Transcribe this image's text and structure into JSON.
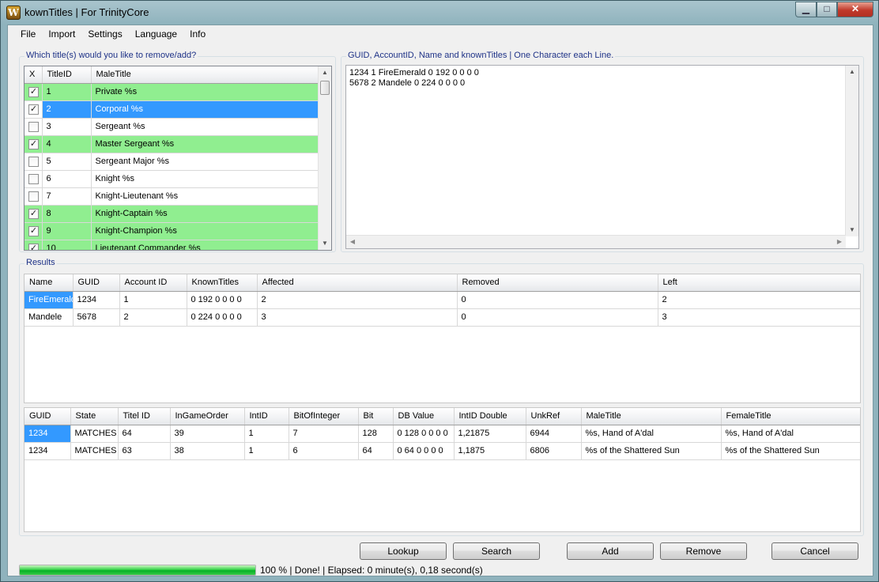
{
  "window": {
    "title": "kownTitles | For TrinityCore",
    "icon_letter": "W"
  },
  "menu": [
    "File",
    "Import",
    "Settings",
    "Language",
    "Info"
  ],
  "titles_group": {
    "label": "Which title(s) would you like to remove/add?",
    "headers": [
      "X",
      "TitleID",
      "MaleTitle"
    ],
    "rows": [
      {
        "checked": true,
        "id": "1",
        "title": "Private %s",
        "highlight": "green"
      },
      {
        "checked": true,
        "id": "2",
        "title": "Corporal %s",
        "highlight": "selected"
      },
      {
        "checked": false,
        "id": "3",
        "title": "Sergeant %s",
        "highlight": "none"
      },
      {
        "checked": true,
        "id": "4",
        "title": "Master Sergeant %s",
        "highlight": "green"
      },
      {
        "checked": false,
        "id": "5",
        "title": "Sergeant Major %s",
        "highlight": "none"
      },
      {
        "checked": false,
        "id": "6",
        "title": "Knight %s",
        "highlight": "none"
      },
      {
        "checked": false,
        "id": "7",
        "title": "Knight-Lieutenant %s",
        "highlight": "none"
      },
      {
        "checked": true,
        "id": "8",
        "title": "Knight-Captain %s",
        "highlight": "green"
      },
      {
        "checked": true,
        "id": "9",
        "title": "Knight-Champion %s",
        "highlight": "green"
      },
      {
        "checked": true,
        "id": "10",
        "title": "Lieutenant Commander %s",
        "highlight": "green"
      }
    ]
  },
  "input_group": {
    "label": "GUID, AccountID, Name and knownTitles | One Character each Line.",
    "text": "1234 1 FireEmerald 0 192 0 0 0 0\n5678 2 Mandele 0 224 0 0 0 0"
  },
  "results": {
    "label": "Results",
    "grid1": {
      "headers": [
        "Name",
        "GUID",
        "Account ID",
        "KnownTitles",
        "Affected",
        "Removed",
        "Left"
      ],
      "rows": [
        [
          "FireEmerald",
          "1234",
          "1",
          "0 192 0 0 0 0",
          "2",
          "0",
          "2"
        ],
        [
          "Mandele",
          "5678",
          "2",
          "0 224 0 0 0 0",
          "3",
          "0",
          "3"
        ]
      ]
    },
    "grid2": {
      "headers": [
        "GUID",
        "State",
        "Titel ID",
        "InGameOrder",
        "IntID",
        "BitOfInteger",
        "Bit",
        "DB Value",
        "IntID Double",
        "UnkRef",
        "MaleTitle",
        "FemaleTitle"
      ],
      "rows": [
        [
          "1234",
          "MATCHES",
          "64",
          "39",
          "1",
          "7",
          "128",
          "0 128 0 0 0 0",
          "1,21875",
          "6944",
          "%s, Hand of A'dal",
          "%s, Hand of A'dal"
        ],
        [
          "1234",
          "MATCHES",
          "63",
          "38",
          "1",
          "6",
          "64",
          "0 64 0 0 0 0",
          "1,1875",
          "6806",
          "%s of the Shattered Sun",
          "%s of the Shattered Sun"
        ]
      ]
    }
  },
  "buttons": {
    "lookup": "Lookup",
    "search": "Search",
    "add": "Add",
    "remove": "Remove",
    "cancel": "Cancel"
  },
  "status": {
    "progress_percent": 100,
    "text": "100 % |  Done!  | Elapsed: 0 minute(s), 0,18 second(s)"
  },
  "colors": {
    "checked_row": "#90ee90",
    "selection": "#3399ff",
    "progress": "#06b025"
  }
}
